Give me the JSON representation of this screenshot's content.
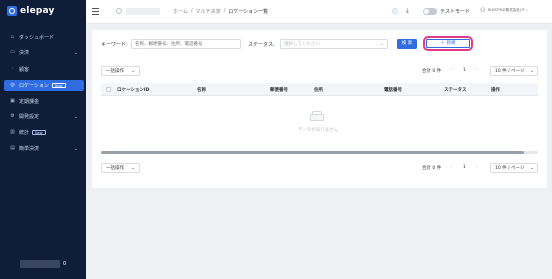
{
  "brand": {
    "name": "elepay"
  },
  "sidebar": {
    "items": [
      {
        "label": "ダッシュボード",
        "icon": "dashboard-icon",
        "glyph": "▫"
      },
      {
        "label": "決済",
        "icon": "payment-icon",
        "glyph": "▭",
        "expandable": true
      },
      {
        "label": "顧客",
        "icon": "customer-icon",
        "glyph": "◦"
      },
      {
        "label": "ロケーション",
        "icon": "location-icon",
        "glyph": "◎",
        "badge": "New",
        "active": true
      },
      {
        "label": "定期課金",
        "icon": "subscription-icon",
        "glyph": "▣"
      },
      {
        "label": "開発設定",
        "icon": "developer-icon",
        "glyph": "⚙",
        "expandable": true
      },
      {
        "label": "統計",
        "icon": "stats-icon",
        "glyph": "▥",
        "badge": "New"
      },
      {
        "label": "簡単決済",
        "icon": "easy-pay-icon",
        "glyph": "▤",
        "expandable": true
      }
    ],
    "bottom_number": "0"
  },
  "header": {
    "breadcrumb": [
      "ホーム",
      "マルチ決済",
      "ロケーション一覧"
    ],
    "test_mode_label": "テストモード",
    "user_name": "ELESTYLE株式会社(テ..."
  },
  "filters": {
    "keyword_label": "キーワード:",
    "keyword_placeholder": "名称、郵便番号、住所、電話番号",
    "status_label": "ステータス:",
    "status_placeholder": "選択してください",
    "search_button": "検 索",
    "new_button": "＋ 新規"
  },
  "toolbar": {
    "batch_label": "一括操作",
    "total": "合計 0 件",
    "page": "1",
    "per_page": "10 件 / ページ"
  },
  "table": {
    "columns": [
      "ロケーションID",
      "名称",
      "郵便番号",
      "住所",
      "電話番号",
      "ステータス",
      "操作"
    ],
    "empty_text": "データがありません"
  },
  "colors": {
    "accent": "#2f6de1",
    "sidebar_bg": "#0f1d39",
    "highlight": "#e23a8a"
  }
}
